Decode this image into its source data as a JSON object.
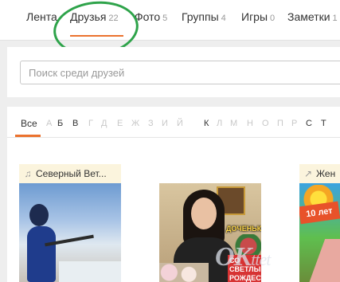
{
  "nav": {
    "tabs": [
      {
        "label": "Лента",
        "count": ""
      },
      {
        "label": "Друзья",
        "count": "22"
      },
      {
        "label": "Фото",
        "count": "5"
      },
      {
        "label": "Группы",
        "count": "4"
      },
      {
        "label": "Игры",
        "count": "0"
      },
      {
        "label": "Заметки",
        "count": "1"
      }
    ],
    "active_tab": "Друзья",
    "accent_color": "#eb722e",
    "highlight_color": "#2ea34a"
  },
  "search": {
    "placeholder": "Поиск среди друзей"
  },
  "letters": {
    "all_label": "Все",
    "items": [
      "А",
      "Б",
      "В",
      "Г",
      "Д",
      "Е",
      "Ж",
      "З",
      "И",
      "Й",
      "К",
      "Л",
      "М",
      "Н",
      "О",
      "П",
      "Р",
      "С",
      "Т"
    ],
    "active_letters": [
      "Б",
      "В",
      "К",
      "С",
      "Т"
    ]
  },
  "cards": [
    {
      "title": "Северный Вет...",
      "icon": "music-note-icon"
    },
    {
      "title": "",
      "icon": "",
      "overlay_top": "ДОЧЕНЬКА",
      "overlay_bottom": "СО СВЕТЛЫМ РОЖДЕСТВОМ!"
    },
    {
      "title": "Жен",
      "icon": "external-link-icon",
      "overlay_tag": "10 лет"
    }
  ],
  "watermark": {
    "text": "OK",
    "sub": "ttet"
  }
}
